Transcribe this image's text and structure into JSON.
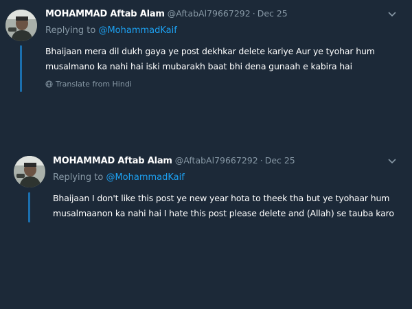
{
  "tweets": [
    {
      "display_name": "MOHAMMAD Aftab Alam",
      "handle": "@AftabAl79667292",
      "separator": "·",
      "date": "Dec 25",
      "replying_prefix": "Replying to",
      "replying_to": "@MohammadKaif",
      "text": "Bhaijaan mera dil dukh gaya ye post dekhkar delete kariye Aur ye tyohar hum musalmano ka nahi hai iski mubarakh baat bhi dena gunaah e kabira hai",
      "translate": "Translate from Hindi",
      "avatar_icon": "user-avatar-photo",
      "menu_icon": "chevron-down-icon"
    },
    {
      "display_name": "MOHAMMAD Aftab Alam",
      "handle": "@AftabAl79667292",
      "separator": "·",
      "date": "Dec 25",
      "replying_prefix": "Replying to",
      "replying_to": "@MohammadKaif",
      "text": "Bhaijaan I don't like this post ye new year hota to theek tha but ye tyohaar hum musalmaanon ka nahi hai I hate this post please delete and (Allah) se tauba karo",
      "avatar_icon": "user-avatar-photo",
      "menu_icon": "chevron-down-icon"
    }
  ],
  "colors": {
    "background": "#1c2938",
    "muted": "#8899a6",
    "link": "#1da1f2",
    "thread_line": "#1b6fae",
    "text": "#ffffff"
  }
}
